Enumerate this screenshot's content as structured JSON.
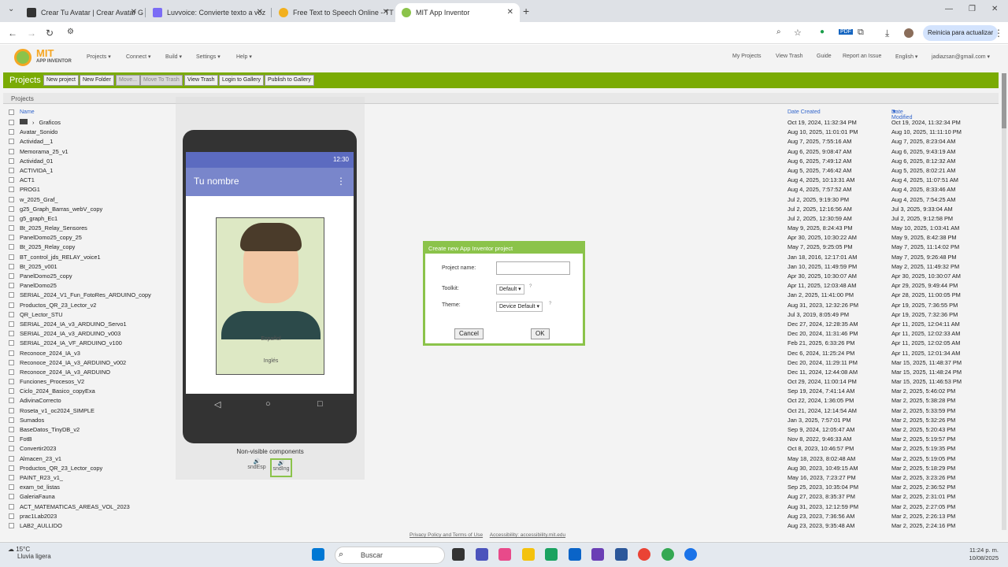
{
  "browser": {
    "tabs": [
      {
        "label": "Crear Tu Avatar | Crear Avatar G",
        "color": "#333333"
      },
      {
        "label": "Luvvoice: Convierte texto a voz",
        "color": "#7b6cf5"
      },
      {
        "label": "Free Text to Speech Online - TT",
        "color": "#f2b01e"
      },
      {
        "label": "MIT App Inventor",
        "color": "#8bc34a"
      }
    ],
    "update_button": "Reinicia para actualizar"
  },
  "appinventor": {
    "logo_title": "MIT",
    "logo_sub": "APP INVENTOR",
    "menu": [
      "Projects",
      "Connect",
      "Build",
      "Settings",
      "Help"
    ],
    "user_menu": [
      "My Projects",
      "View Trash",
      "Guide",
      "Report an Issue",
      "English",
      "jadiazsan@gmail.com"
    ],
    "toolbar_title": "Projects",
    "toolbar_buttons": [
      "New project",
      "New Folder",
      "Move...",
      "Move To Trash",
      "View Trash",
      "Login to Gallery",
      "Publish to Gallery"
    ],
    "section_title": "Projects",
    "col_name": "Name",
    "col_created": "Date Created",
    "col_modified": "Date Modified",
    "projects": [
      {
        "name": "Graficos",
        "created": "Oct 19, 2024, 11:32:34 PM",
        "modified": "Oct 19, 2024, 11:32:34 PM"
      },
      {
        "name": "Avatar_Sonido",
        "created": "Aug 10, 2025, 11:01:01 PM",
        "modified": "Aug 10, 2025, 11:11:10 PM"
      },
      {
        "name": "Actividad__1",
        "created": "Aug 7, 2025, 7:55:16 AM",
        "modified": "Aug 7, 2025, 8:23:04 AM"
      },
      {
        "name": "Memorama_25_v1",
        "created": "Aug 6, 2025, 9:08:47 AM",
        "modified": "Aug 6, 2025, 9:43:19 AM"
      },
      {
        "name": "Actividad_01",
        "created": "Aug 6, 2025, 7:49:12 AM",
        "modified": "Aug 6, 2025, 8:12:32 AM"
      },
      {
        "name": "ACTIVIDA_1",
        "created": "Aug 5, 2025, 7:46:42 AM",
        "modified": "Aug 5, 2025, 8:02:21 AM"
      },
      {
        "name": "ACT1",
        "created": "Aug 4, 2025, 10:13:31 AM",
        "modified": "Aug 4, 2025, 11:07:51 AM"
      },
      {
        "name": "PROG1",
        "created": "Aug 4, 2025, 7:57:52 AM",
        "modified": "Aug 4, 2025, 8:33:46 AM"
      },
      {
        "name": "w_2025_Graf_",
        "created": "Jul 2, 2025, 9:19:30 PM",
        "modified": "Aug 4, 2025, 7:54:25 AM"
      },
      {
        "name": "g25_Graph_Barras_webV_copy",
        "created": "Jul 2, 2025, 12:16:56 AM",
        "modified": "Jul 3, 2025, 9:33:04 AM"
      },
      {
        "name": "g5_graph_Ec1",
        "created": "Jul 2, 2025, 12:30:59 AM",
        "modified": "Jul 2, 2025, 9:12:58 PM"
      },
      {
        "name": "Bt_2025_Relay_Sensores",
        "created": "May 9, 2025, 8:24:43 PM",
        "modified": "May 10, 2025, 1:03:41 AM"
      },
      {
        "name": "PanelDomo25_copy_25",
        "created": "Apr 30, 2025, 10:30:22 AM",
        "modified": "May 9, 2025, 8:42:38 PM"
      },
      {
        "name": "Bt_2025_Relay_copy",
        "created": "May 7, 2025, 9:25:05 PM",
        "modified": "May 7, 2025, 11:14:02 PM"
      },
      {
        "name": "BT_control_jds_RELAY_voice1",
        "created": "Jan 18, 2016, 12:17:01 AM",
        "modified": "May 7, 2025, 9:26:48 PM"
      },
      {
        "name": "Bt_2025_v001",
        "created": "Jan 10, 2025, 11:49:59 PM",
        "modified": "May 2, 2025, 11:49:32 PM"
      },
      {
        "name": "PanelDomo25_copy",
        "created": "Apr 30, 2025, 10:30:07 AM",
        "modified": "Apr 30, 2025, 10:30:07 AM"
      },
      {
        "name": "PanelDomo25",
        "created": "Apr 11, 2025, 12:03:48 AM",
        "modified": "Apr 29, 2025, 9:49:44 PM"
      },
      {
        "name": "SERIAL_2024_V1_Fun_FotoRes_ARDUINO_copy",
        "created": "Jan 2, 2025, 11:41:00 PM",
        "modified": "Apr 28, 2025, 11:00:05 PM"
      },
      {
        "name": "Productos_QR_23_Lector_v2",
        "created": "Aug 31, 2023, 12:32:26 PM",
        "modified": "Apr 19, 2025, 7:36:55 PM"
      },
      {
        "name": "QR_Lector_STU",
        "created": "Jul 3, 2019, 8:05:49 PM",
        "modified": "Apr 19, 2025, 7:32:36 PM"
      },
      {
        "name": "SERIAL_2024_IA_v3_ARDUINO_Servo1",
        "created": "Dec 27, 2024, 12:28:35 AM",
        "modified": "Apr 11, 2025, 12:04:11 AM"
      },
      {
        "name": "SERIAL_2024_IA_v3_ARDUINO_v003",
        "created": "Dec 20, 2024, 11:31:46 PM",
        "modified": "Apr 11, 2025, 12:02:33 AM"
      },
      {
        "name": "SERIAL_2024_IA_VF_ARDUINO_v100",
        "created": "Feb 21, 2025, 6:33:26 PM",
        "modified": "Apr 11, 2025, 12:02:05 AM"
      },
      {
        "name": "Reconoce_2024_IA_v3",
        "created": "Dec 6, 2024, 11:25:24 PM",
        "modified": "Apr 11, 2025, 12:01:34 AM"
      },
      {
        "name": "Reconoce_2024_IA_v3_ARDUINO_v002",
        "created": "Dec 20, 2024, 11:29:11 PM",
        "modified": "Mar 15, 2025, 11:48:37 PM"
      },
      {
        "name": "Reconoce_2024_IA_v3_ARDUINO",
        "created": "Dec 11, 2024, 12:44:08 AM",
        "modified": "Mar 15, 2025, 11:48:24 PM"
      },
      {
        "name": "Funciones_Procesos_V2",
        "created": "Oct 29, 2024, 11:00:14 PM",
        "modified": "Mar 15, 2025, 11:46:53 PM"
      },
      {
        "name": "Ciclo_2024_Basico_copyExa",
        "created": "Sep 19, 2024, 7:41:14 AM",
        "modified": "Mar 2, 2025, 5:46:02 PM"
      },
      {
        "name": "AdivinaCorrecto",
        "created": "Oct 22, 2024, 1:36:05 PM",
        "modified": "Mar 2, 2025, 5:38:28 PM"
      },
      {
        "name": "Roseta_v1_oc2024_SIMPLE",
        "created": "Oct 21, 2024, 12:14:54 AM",
        "modified": "Mar 2, 2025, 5:33:59 PM"
      },
      {
        "name": "Sumados",
        "created": "Jan 3, 2025, 7:57:01 PM",
        "modified": "Mar 2, 2025, 5:32:26 PM"
      },
      {
        "name": "BaseDatos_TinyDB_v2",
        "created": "Sep 9, 2024, 12:05:47 AM",
        "modified": "Mar 2, 2025, 5:20:43 PM"
      },
      {
        "name": "FotB",
        "created": "Nov 8, 2022, 9:46:33 AM",
        "modified": "Mar 2, 2025, 5:19:57 PM"
      },
      {
        "name": "Convertir2023",
        "created": "Oct 8, 2023, 10:46:57 PM",
        "modified": "Mar 2, 2025, 5:19:35 PM"
      },
      {
        "name": "Almacen_23_v1",
        "created": "May 18, 2023, 8:02:48 AM",
        "modified": "Mar 2, 2025, 5:19:05 PM"
      },
      {
        "name": "Productos_QR_23_Lector_copy",
        "created": "Aug 30, 2023, 10:49:15 AM",
        "modified": "Mar 2, 2025, 5:18:29 PM"
      },
      {
        "name": "PAINT_R23_v1_",
        "created": "May 16, 2023, 7:23:27 PM",
        "modified": "Mar 2, 2025, 3:23:26 PM"
      },
      {
        "name": "exam_txt_listas",
        "created": "Sep 25, 2023, 10:35:04 PM",
        "modified": "Mar 2, 2025, 2:36:52 PM"
      },
      {
        "name": "GaleriaFauna",
        "created": "Aug 27, 2023, 8:35:37 PM",
        "modified": "Mar 2, 2025, 2:31:01 PM"
      },
      {
        "name": "ACT_MATEMATICAS_AREAS_VOL_2023",
        "created": "Aug 31, 2023, 12:12:59 PM",
        "modified": "Mar 2, 2025, 2:27:05 PM"
      },
      {
        "name": "prac1Lab2023",
        "created": "Aug 23, 2023, 7:36:56 AM",
        "modified": "Mar 2, 2025, 2:26:13 PM"
      },
      {
        "name": "LAB2_AULLIDO",
        "created": "Aug 23, 2023, 9:35:48 AM",
        "modified": "Mar 2, 2025, 2:24:16 PM"
      }
    ],
    "footer_privacy": "Privacy Policy and Terms of Use",
    "footer_access": "Accessibility: accessibility.mit.edu"
  },
  "phone": {
    "time": "12:30",
    "app_title": "Tu nombre",
    "lang_es": "Español",
    "lang_en": "Inglés",
    "nonvisible_title": "Non-visible components",
    "components": [
      "sndEsp",
      "sndIng"
    ]
  },
  "dialog": {
    "title": "Create new App Inventor project",
    "project_name_label": "Project name:",
    "project_name_value": "",
    "toolkit_label": "Toolkit:",
    "toolkit_value": "Default",
    "theme_label": "Theme:",
    "theme_value": "Device Default",
    "cancel": "Cancel",
    "ok": "OK"
  },
  "taskbar": {
    "temp": "15°C",
    "weather": "Lluvia ligera",
    "search": "Buscar",
    "time": "11:24 p. m.",
    "date": "10/08/2025"
  }
}
